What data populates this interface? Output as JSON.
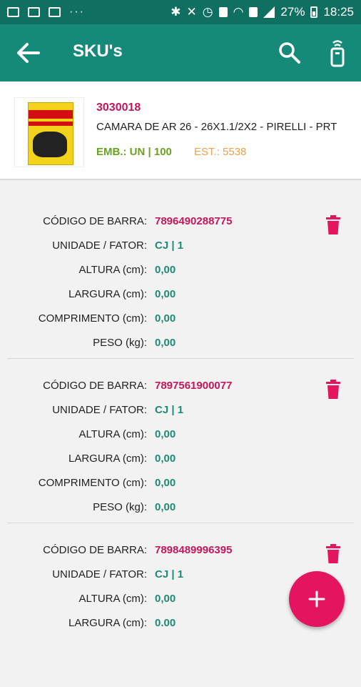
{
  "status_bar": {
    "battery": "27%",
    "time": "18:25",
    "icons": [
      "image-icon",
      "message-icon",
      "calendar-icon",
      "more-icon",
      "bluetooth-icon",
      "mute-icon",
      "alarm-icon",
      "volte-icon",
      "wifi-icon",
      "sim-icon",
      "signal-icon",
      "battery-icon"
    ],
    "dots": "···"
  },
  "app_bar": {
    "title": "SKU's",
    "background": "#168a79",
    "icons": [
      "back-arrow-icon",
      "search-icon",
      "remote-icon"
    ]
  },
  "product": {
    "code": "3030018",
    "name": "CAMARA DE AR 26 - 26X1.1/2X2 - PIRELLI - PRT",
    "emb": "EMB.: UN | 100",
    "est": "EST.: 5538"
  },
  "labels": {
    "barcode": "CÓDIGO DE BARRA:",
    "unit": "UNIDADE / FATOR:",
    "height": "ALTURA (cm):",
    "width": "LARGURA (cm):",
    "length": "COMPRIMENTO (cm):",
    "weight": "PESO (kg):"
  },
  "skus": [
    {
      "barcode": "7896490288775",
      "unit": "CJ | 1",
      "height": "0,00",
      "width": "0,00",
      "length": "0,00",
      "weight": "0,00"
    },
    {
      "barcode": "7897561900077",
      "unit": "CJ | 1",
      "height": "0,00",
      "width": "0,00",
      "length": "0,00",
      "weight": "0,00"
    },
    {
      "barcode": "7898489996395",
      "unit": "CJ | 1",
      "height": "0,00",
      "width": "0.00"
    }
  ],
  "colors": {
    "accent_pink": "#c2185b",
    "value_green": "#1f8a73",
    "emb_green": "#6aa121",
    "est_orange": "#f0a050",
    "fab": "#e4145f"
  }
}
